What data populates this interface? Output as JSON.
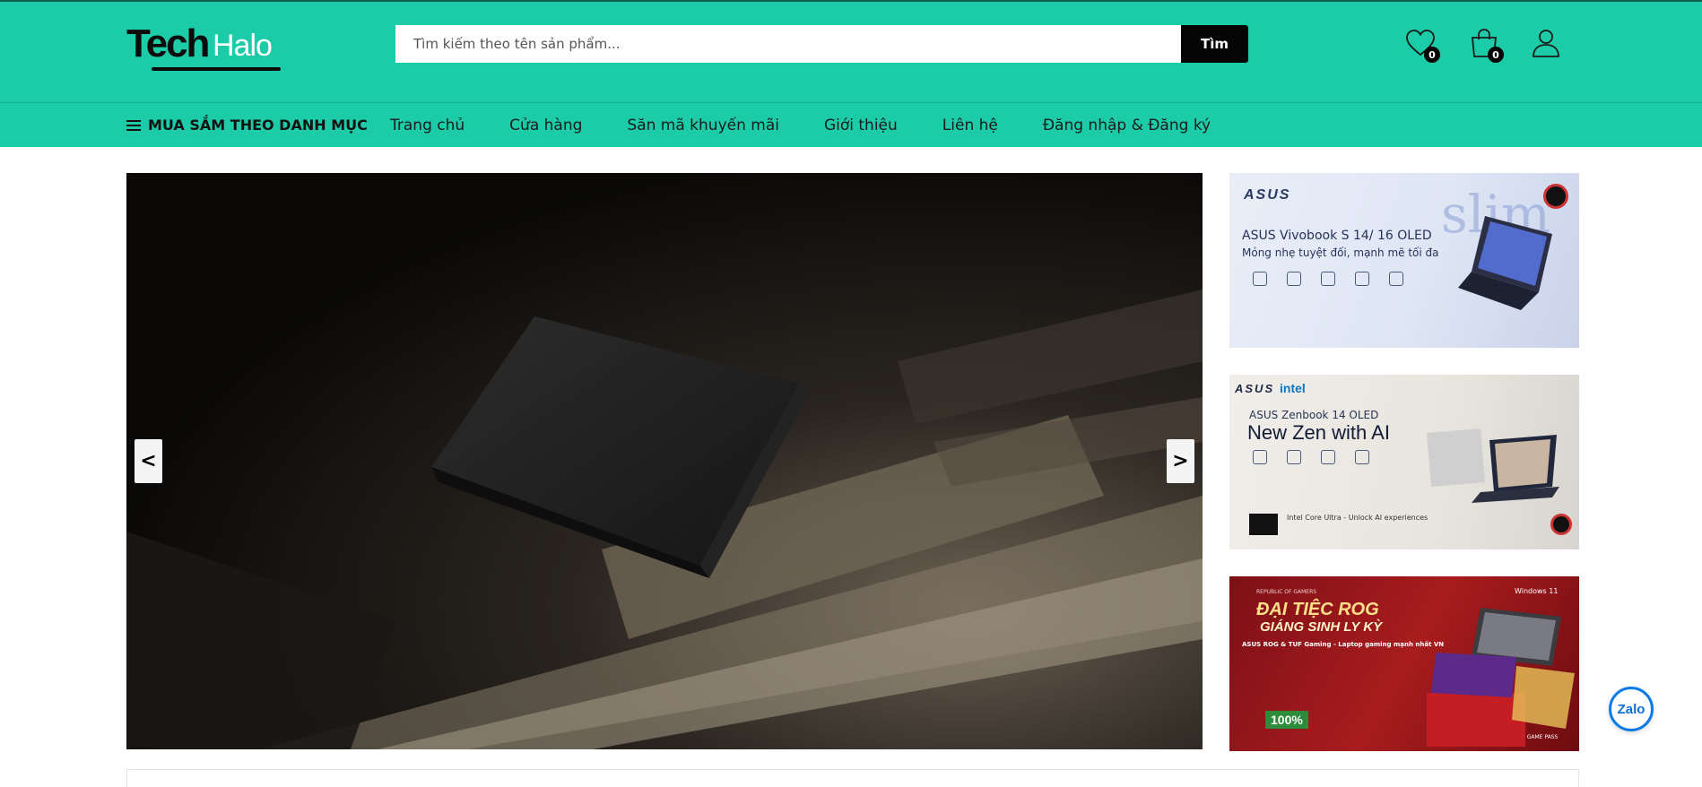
{
  "brand": {
    "logo_dark": "Tech",
    "logo_light": "Halo"
  },
  "search": {
    "placeholder": "Tìm kiếm theo tên sản phẩm...",
    "button_label": "Tìm"
  },
  "header_icons": {
    "wishlist_count": "0",
    "cart_count": "0"
  },
  "nav": {
    "category_label": "MUA SẮM THEO DANH MỤC",
    "items": [
      {
        "label": "Trang chủ"
      },
      {
        "label": "Cửa hàng"
      },
      {
        "label": "Săn mã khuyến mãi"
      },
      {
        "label": "Giới thiệu"
      },
      {
        "label": "Liên hệ"
      },
      {
        "label": "Đăng nhập & Đăng ký"
      }
    ]
  },
  "slider": {
    "prev_label": "<",
    "next_label": ">"
  },
  "banners": [
    {
      "brand": "ASUS",
      "title": "ASUS Vivobook S 14/ 16 OLED",
      "subtitle": "Mỏng nhẹ tuyệt đối, mạnh mẽ tối đa",
      "deco": "slim"
    },
    {
      "brand": "ASUS",
      "partner": "intel",
      "title": "ASUS Zenbook 14 OLED",
      "subtitle": "New Zen with AI",
      "footnote": "Intel Core Ultra - Unlock AI experiences"
    },
    {
      "brand": "REPUBLIC OF GAMERS",
      "title": "ĐẠI TIỆC ROG",
      "subtitle": "GIÁNG SINH LY KỲ",
      "tagline": "ASUS ROG & TUF Gaming - Laptop gaming mạnh nhất VN",
      "badge": "Windows 11",
      "promo": "100%",
      "footer": "PC GAME PASS"
    }
  ],
  "zalo": {
    "label": "Zalo"
  },
  "colors": {
    "header_bg": "#1ccca8",
    "button_bg": "#050505"
  }
}
